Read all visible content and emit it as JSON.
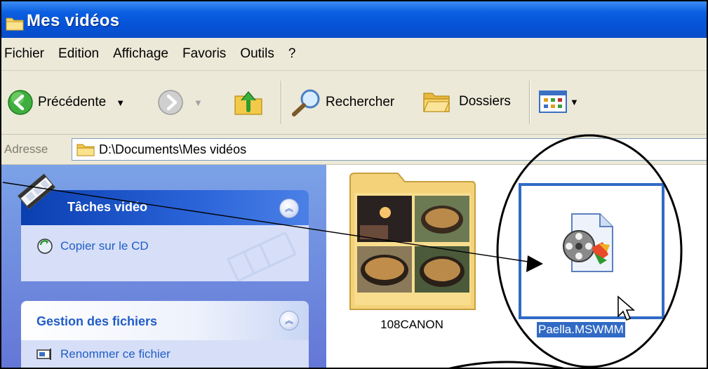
{
  "window": {
    "title": "Mes vidéos"
  },
  "menu": [
    "Fichier",
    "Edition",
    "Affichage",
    "Favoris",
    "Outils",
    "?"
  ],
  "toolbar": {
    "back_label": "Précédente",
    "search_label": "Rechercher",
    "folders_label": "Dossiers"
  },
  "address": {
    "label": "Adresse",
    "value": "D:\\Documents\\Mes vidéos"
  },
  "tasks": {
    "video": {
      "title": "Tâches vidéo",
      "items": [
        "Copier sur le CD"
      ]
    },
    "files": {
      "title": "Gestion des fichiers",
      "items": [
        "Renommer ce fichier"
      ]
    }
  },
  "files": [
    {
      "name": "108CANON",
      "type": "folder",
      "selected": false
    },
    {
      "name": "Paella.MSWMM",
      "type": "movie-maker-project",
      "selected": true
    }
  ],
  "colors": {
    "titlebar": "#0a5fe0",
    "chrome": "#ece9d8",
    "taskpane": "#6f8ee0",
    "selection": "#316ac5"
  }
}
